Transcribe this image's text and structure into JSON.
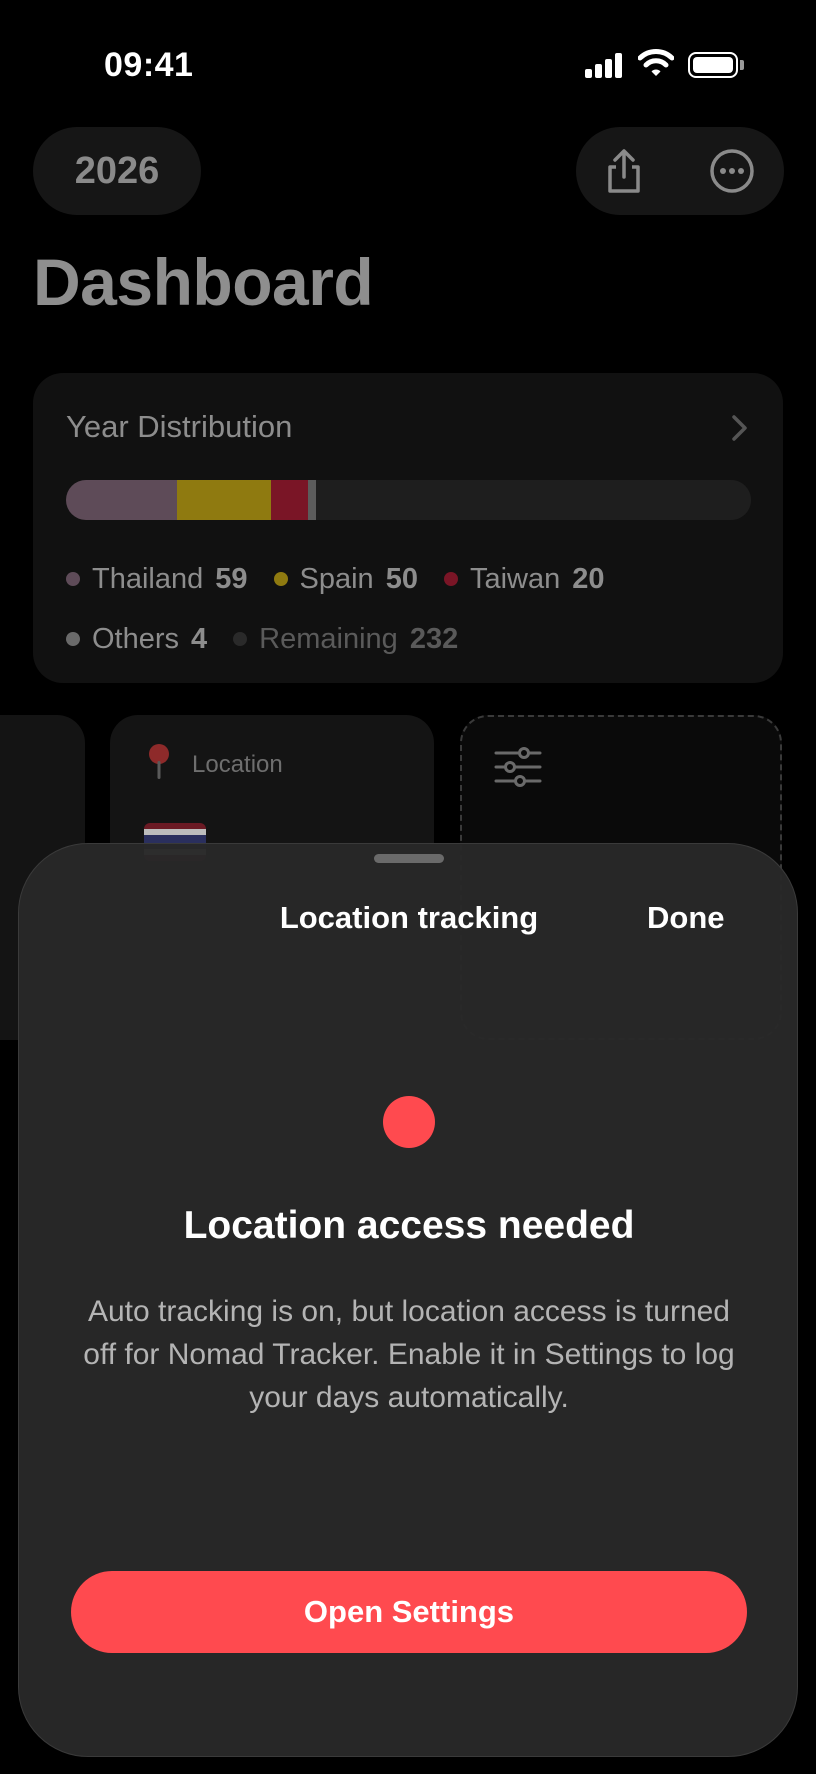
{
  "status_bar": {
    "time": "09:41"
  },
  "header": {
    "year": "2026",
    "title": "Dashboard"
  },
  "year_distribution": {
    "title": "Year Distribution",
    "bar_segments": [
      {
        "name": "Thailand",
        "days": 59,
        "color": "#5e4b58"
      },
      {
        "name": "Spain",
        "days": 50,
        "color": "#8f7a10"
      },
      {
        "name": "Taiwan",
        "days": 20,
        "color": "#7a1526"
      },
      {
        "name": "Others",
        "days": 4,
        "color": "#5c5c5c"
      },
      {
        "name": "Remaining",
        "days": 232,
        "color": "#1e1e1e"
      }
    ],
    "legend": [
      {
        "label": "Thailand",
        "value": "59",
        "color": "#5e4b58"
      },
      {
        "label": "Spain",
        "value": "50",
        "color": "#8f7a10"
      },
      {
        "label": "Taiwan",
        "value": "20",
        "color": "#7a1526"
      },
      {
        "label": "Others",
        "value": "4",
        "color": "#6a6a6a"
      },
      {
        "label": "Remaining",
        "value": "232",
        "color": "#2a2a2a"
      }
    ]
  },
  "tiles": {
    "location_label": "Location"
  },
  "sheet": {
    "title": "Location tracking",
    "done_label": "Done",
    "alert_title": "Location access needed",
    "alert_body": "Auto tracking is on, but location access is turned off for Nomad Tracker. Enable it in Settings to log your days automatically.",
    "button_label": "Open Settings",
    "accent_color": "#ff4a4f"
  }
}
